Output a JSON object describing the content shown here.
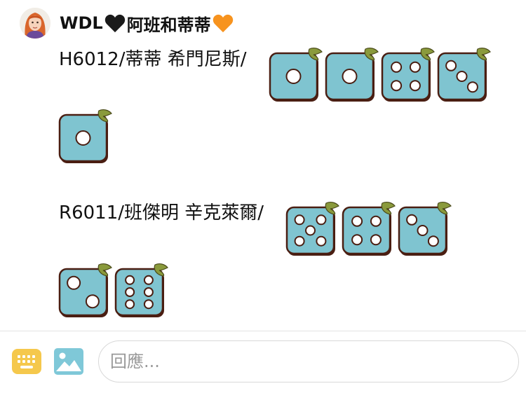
{
  "post": {
    "author": {
      "name_prefix": "WDL",
      "name_middle": "阿班和蒂蒂",
      "hearts": [
        "black-heart-icon",
        "orange-heart-icon"
      ]
    },
    "rolls": [
      {
        "label": "H6012/蒂蒂 希門尼斯/",
        "dice": [
          1,
          1,
          4,
          3,
          1
        ]
      },
      {
        "label": "R6011/班傑明 辛克萊爾/",
        "dice": [
          5,
          4,
          3,
          2,
          6
        ]
      }
    ]
  },
  "composer": {
    "placeholder": "回應...",
    "keyboard_icon": "keyboard-icon",
    "image_icon": "image-icon"
  },
  "colors": {
    "die_face": "#7fc4d0",
    "die_border": "#4a1e12",
    "leaf": "#8a9a3c",
    "keyboard_icon": "#f5c84c",
    "image_icon": "#7fc8d8",
    "orange_heart": "#f7931e",
    "black_heart": "#1a1a1a"
  }
}
